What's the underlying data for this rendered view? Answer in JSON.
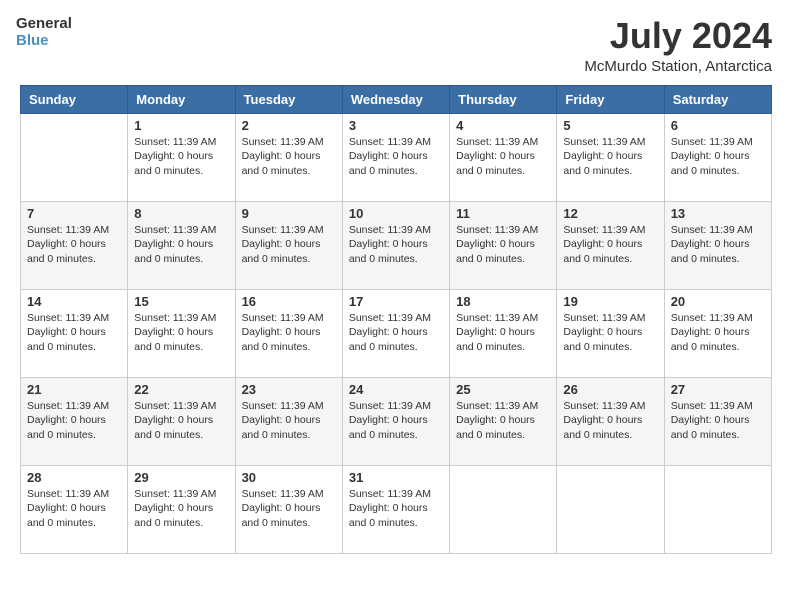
{
  "logo": {
    "line1": "General",
    "line2": "Blue"
  },
  "title": {
    "month_year": "July 2024",
    "location": "McMurdo Station, Antarctica"
  },
  "days_of_week": [
    "Sunday",
    "Monday",
    "Tuesday",
    "Wednesday",
    "Thursday",
    "Friday",
    "Saturday"
  ],
  "day_info_template": "Sunset: 11:39 AM\nDaylight: 0 hours and 0 minutes.",
  "weeks": [
    [
      {
        "day": "",
        "empty": true
      },
      {
        "day": "1"
      },
      {
        "day": "2"
      },
      {
        "day": "3"
      },
      {
        "day": "4"
      },
      {
        "day": "5"
      },
      {
        "day": "6"
      }
    ],
    [
      {
        "day": "7"
      },
      {
        "day": "8"
      },
      {
        "day": "9"
      },
      {
        "day": "10"
      },
      {
        "day": "11"
      },
      {
        "day": "12"
      },
      {
        "day": "13"
      }
    ],
    [
      {
        "day": "14"
      },
      {
        "day": "15"
      },
      {
        "day": "16"
      },
      {
        "day": "17"
      },
      {
        "day": "18"
      },
      {
        "day": "19"
      },
      {
        "day": "20"
      }
    ],
    [
      {
        "day": "21"
      },
      {
        "day": "22"
      },
      {
        "day": "23"
      },
      {
        "day": "24"
      },
      {
        "day": "25"
      },
      {
        "day": "26"
      },
      {
        "day": "27"
      }
    ],
    [
      {
        "day": "28"
      },
      {
        "day": "29"
      },
      {
        "day": "30"
      },
      {
        "day": "31"
      },
      {
        "day": "",
        "empty": true
      },
      {
        "day": "",
        "empty": true
      },
      {
        "day": "",
        "empty": true
      }
    ]
  ]
}
